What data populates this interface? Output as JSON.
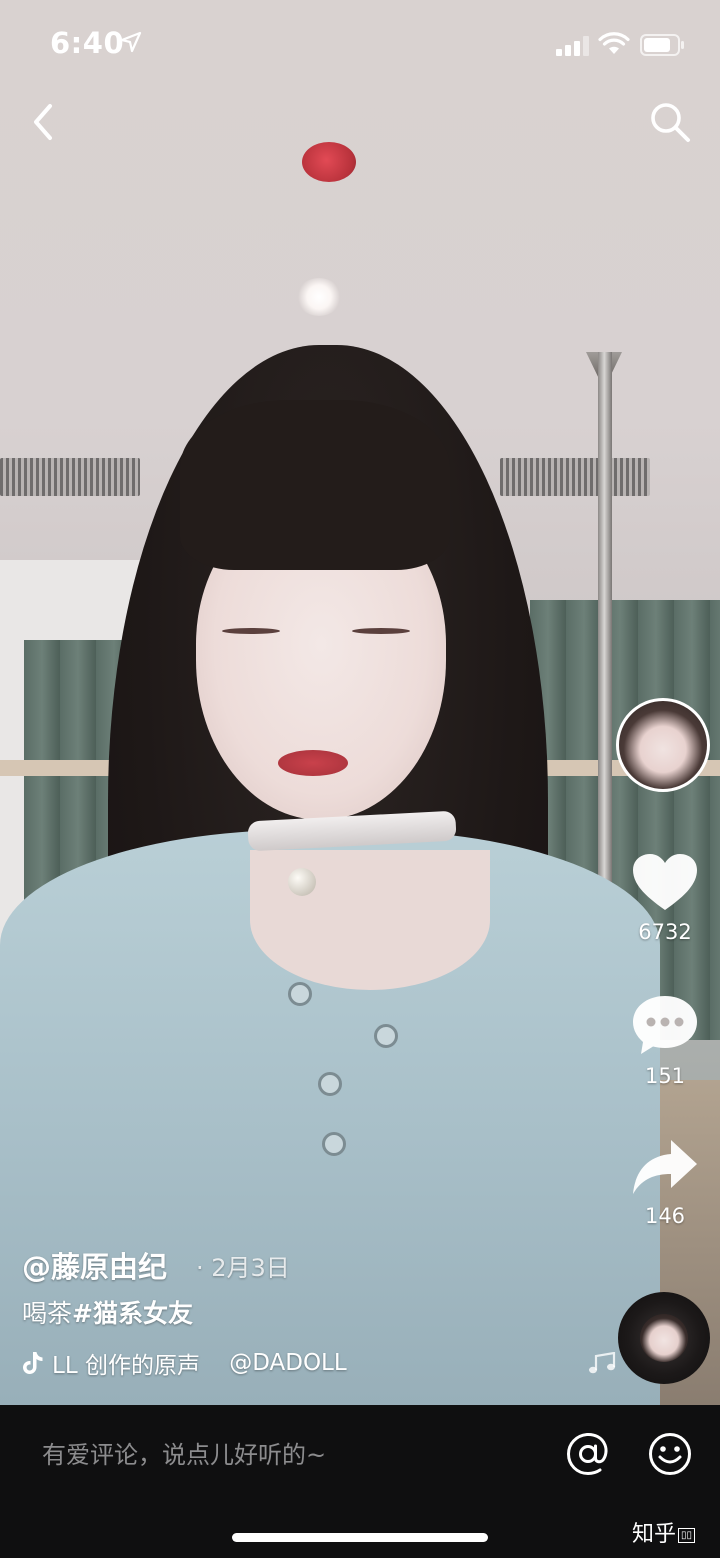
{
  "status_bar": {
    "time": "6:40"
  },
  "post": {
    "author": "@藤原由纪",
    "date": "· 2月3日",
    "caption_text": "喝茶",
    "caption_tag": "#猫系女友",
    "music": "LL 创作的原声",
    "music_mention": "@DADOLL"
  },
  "actions": {
    "likes": "6732",
    "comments": "151",
    "shares": "146"
  },
  "comment_bar": {
    "placeholder": "有爱评论，说点儿好听的~"
  },
  "watermark": "知乎"
}
